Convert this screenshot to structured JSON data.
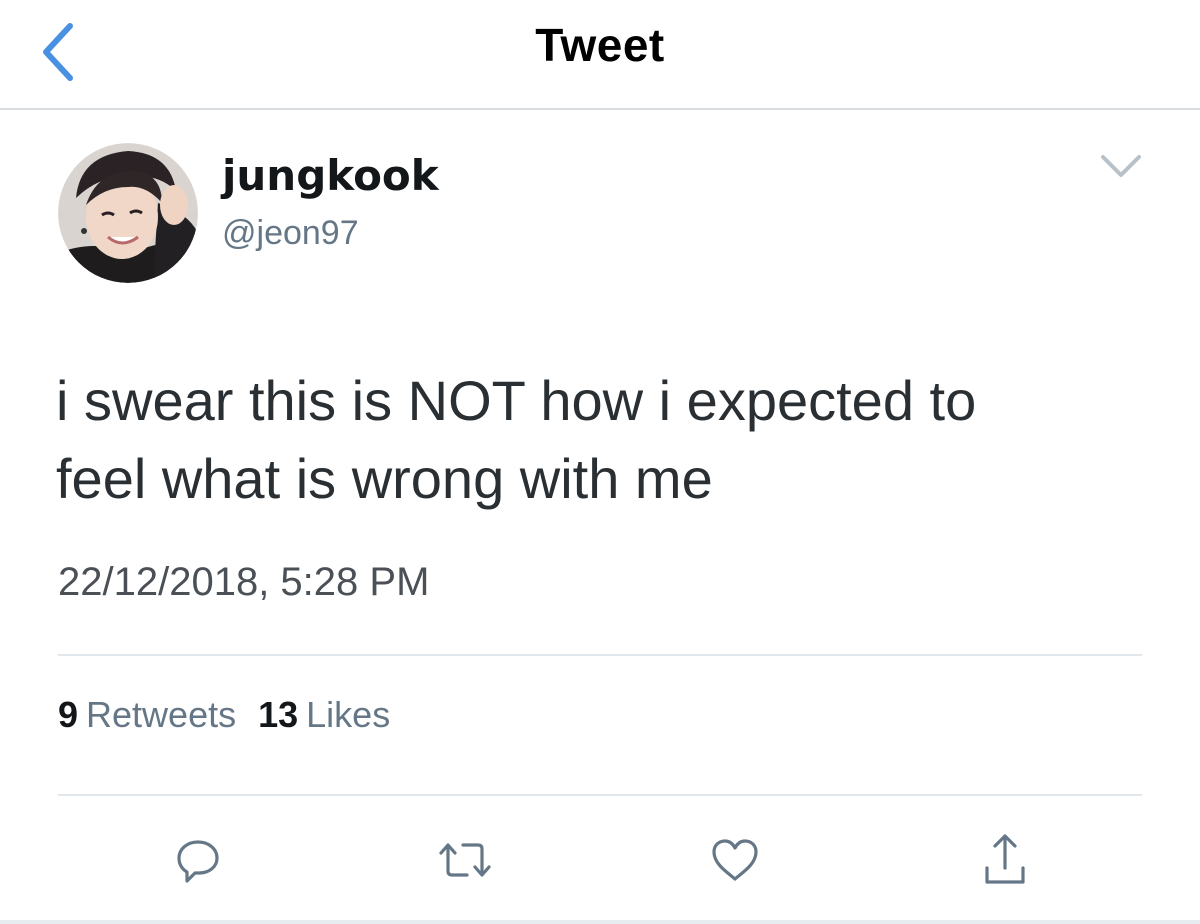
{
  "header": {
    "title": "Tweet",
    "back_icon": "chevron-left-icon"
  },
  "author": {
    "display_name": "jungkook",
    "handle": "@jeon97"
  },
  "tweet": {
    "text_line1": "i swear this is NOT how i expected to",
    "text_line2": "feel what is wrong with me",
    "timestamp": "22/12/2018, 5:28 PM"
  },
  "stats": {
    "retweets_count": "9",
    "retweets_label": "Retweets",
    "likes_count": "13",
    "likes_label": "Likes"
  },
  "actions": {
    "reply_icon": "reply-icon",
    "retweet_icon": "retweet-icon",
    "like_icon": "heart-icon",
    "share_icon": "share-icon"
  },
  "colors": {
    "accent": "#4a90e2",
    "text_primary": "#14171a",
    "text_secondary": "#657786",
    "icon_gray": "#657786",
    "divider": "#e1e8ed"
  }
}
